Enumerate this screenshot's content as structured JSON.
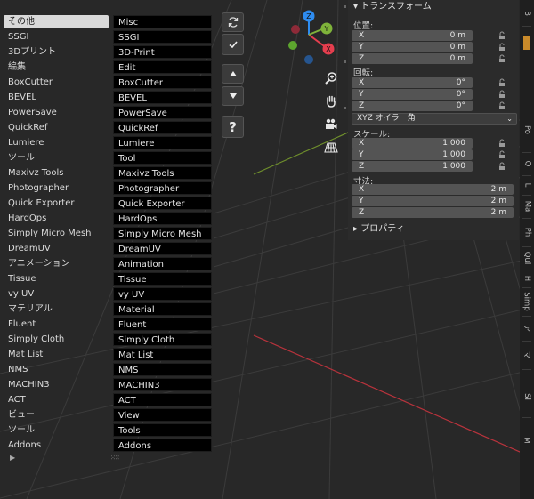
{
  "categories": [
    {
      "label": "その他",
      "value": "Misc",
      "selected": true
    },
    {
      "label": "SSGI",
      "value": "SSGI"
    },
    {
      "label": "3Dプリント",
      "value": "3D-Print"
    },
    {
      "label": "編集",
      "value": "Edit"
    },
    {
      "label": "BoxCutter",
      "value": "BoxCutter"
    },
    {
      "label": "BEVEL",
      "value": "BEVEL"
    },
    {
      "label": "PowerSave",
      "value": "PowerSave"
    },
    {
      "label": "QuickRef",
      "value": "QuickRef"
    },
    {
      "label": "Lumiere",
      "value": "Lumiere"
    },
    {
      "label": "ツール",
      "value": "Tool"
    },
    {
      "label": "Maxivz Tools",
      "value": "Maxivz Tools"
    },
    {
      "label": "Photographer",
      "value": "Photographer"
    },
    {
      "label": "Quick Exporter",
      "value": "Quick Exporter"
    },
    {
      "label": "HardOps",
      "value": "HardOps"
    },
    {
      "label": "Simply Micro Mesh",
      "value": "Simply Micro Mesh"
    },
    {
      "label": "DreamUV",
      "value": "DreamUV"
    },
    {
      "label": "アニメーション",
      "value": "Animation"
    },
    {
      "label": "Tissue",
      "value": "Tissue"
    },
    {
      "label": "vy UV",
      "value": "vy UV"
    },
    {
      "label": "マテリアル",
      "value": "Material"
    },
    {
      "label": "Fluent",
      "value": "Fluent"
    },
    {
      "label": "Simply Cloth",
      "value": "Simply Cloth"
    },
    {
      "label": "Mat List",
      "value": "Mat List"
    },
    {
      "label": "NMS",
      "value": "NMS"
    },
    {
      "label": "MACHIN3",
      "value": "MACHIN3"
    },
    {
      "label": "ACT",
      "value": "ACT"
    },
    {
      "label": "ビュー",
      "value": "View"
    },
    {
      "label": "ツール",
      "value": "Tools"
    },
    {
      "label": "Addons",
      "value": "Addons"
    }
  ],
  "side_buttons": {
    "refresh": "refresh-icon",
    "confirm": "checkmark-icon",
    "move_up": "triangle-up-icon",
    "move_down": "triangle-down-icon",
    "help": "?"
  },
  "gizmo": {
    "z": "Z",
    "y": "Y",
    "x": "X",
    "colors": {
      "x": "#e53e4e",
      "y": "#7fb33a",
      "z": "#2e8cf0"
    }
  },
  "npanel": {
    "transform_header": "トランスフォーム",
    "location_label": "位置:",
    "location": [
      {
        "axis": "X",
        "value": "0 m"
      },
      {
        "axis": "Y",
        "value": "0 m"
      },
      {
        "axis": "Z",
        "value": "0 m"
      }
    ],
    "rotation_label": "回転:",
    "rotation": [
      {
        "axis": "X",
        "value": "0°"
      },
      {
        "axis": "Y",
        "value": "0°"
      },
      {
        "axis": "Z",
        "value": "0°"
      }
    ],
    "rotation_mode": "XYZ オイラー角",
    "scale_label": "スケール:",
    "scale": [
      {
        "axis": "X",
        "value": "1.000"
      },
      {
        "axis": "Y",
        "value": "1.000"
      },
      {
        "axis": "Z",
        "value": "1.000"
      }
    ],
    "dimensions_label": "寸法:",
    "dimensions": [
      {
        "axis": "X",
        "value": "2 m"
      },
      {
        "axis": "Y",
        "value": "2 m"
      },
      {
        "axis": "Z",
        "value": "2 m"
      }
    ],
    "properties_header": "プロパティ"
  },
  "tabs": [
    "B",
    "Po",
    "Q",
    "L",
    "Ma",
    "Ph",
    "Qui",
    "H",
    "Simp",
    "ア",
    "マ",
    "Si",
    "M"
  ],
  "active_tab_color": "#c98a2a"
}
